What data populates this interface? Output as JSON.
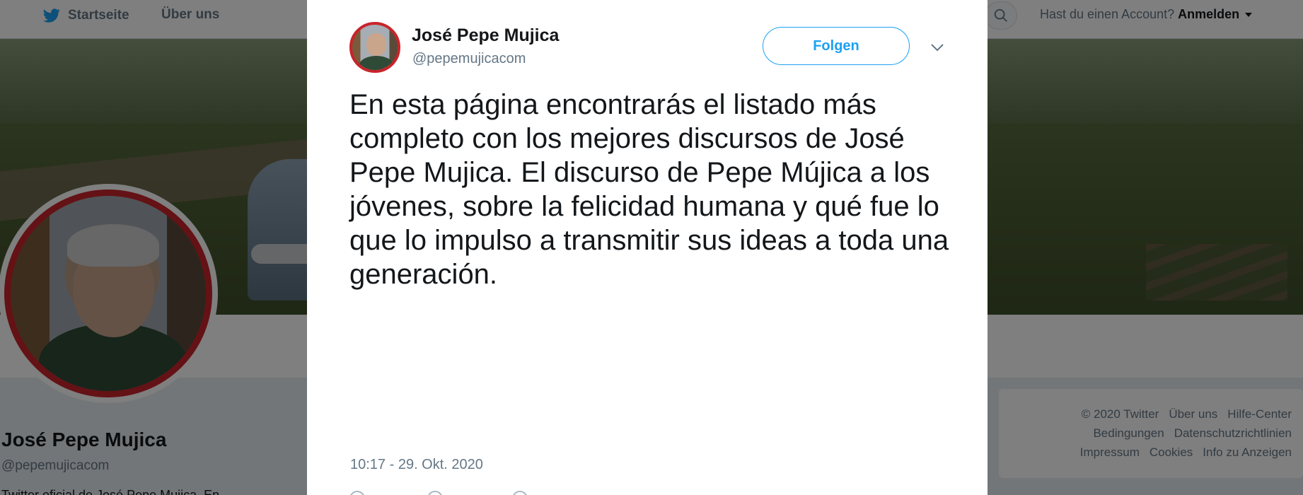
{
  "topnav": {
    "home_label": "Startseite",
    "about_label": "Über uns",
    "account_prompt": "Hast du einen Account?",
    "login_label": "Anmelden",
    "icons": {
      "logo": "twitter-bird-icon",
      "search": "search-icon",
      "caret": "chevron-down-icon"
    }
  },
  "profile": {
    "name": "José Pepe Mujica",
    "handle": "@pepemujicacom",
    "bio_visible": "Twitter oficial de José Pepe Mujica. En"
  },
  "footer": {
    "row1": [
      "© 2020 Twitter",
      "Über uns",
      "Hilfe-Center"
    ],
    "row2": [
      "Bedingungen",
      "Datenschutzrichtlinien"
    ],
    "row3": [
      "Impressum",
      "Cookies",
      "Info zu Anzeigen"
    ]
  },
  "tweet": {
    "author_name": "José Pepe Mujica",
    "author_handle": "@pepemujicacom",
    "follow_label": "Folgen",
    "text": "En esta página encontrarás el listado más completo con los mejores discursos de José Pepe Mujica. El discurso de Pepe Mújica a los jóvenes, sobre la felicidad humana y qué fue lo que lo impulso a transmitir sus ideas a toda una generación.",
    "timestamp": "10:17 - 29. Okt. 2020"
  },
  "colors": {
    "accent": "#1da1f2",
    "avatar_ring": "#c8242b",
    "overlay": "rgba(0,0,0,0.5)"
  }
}
